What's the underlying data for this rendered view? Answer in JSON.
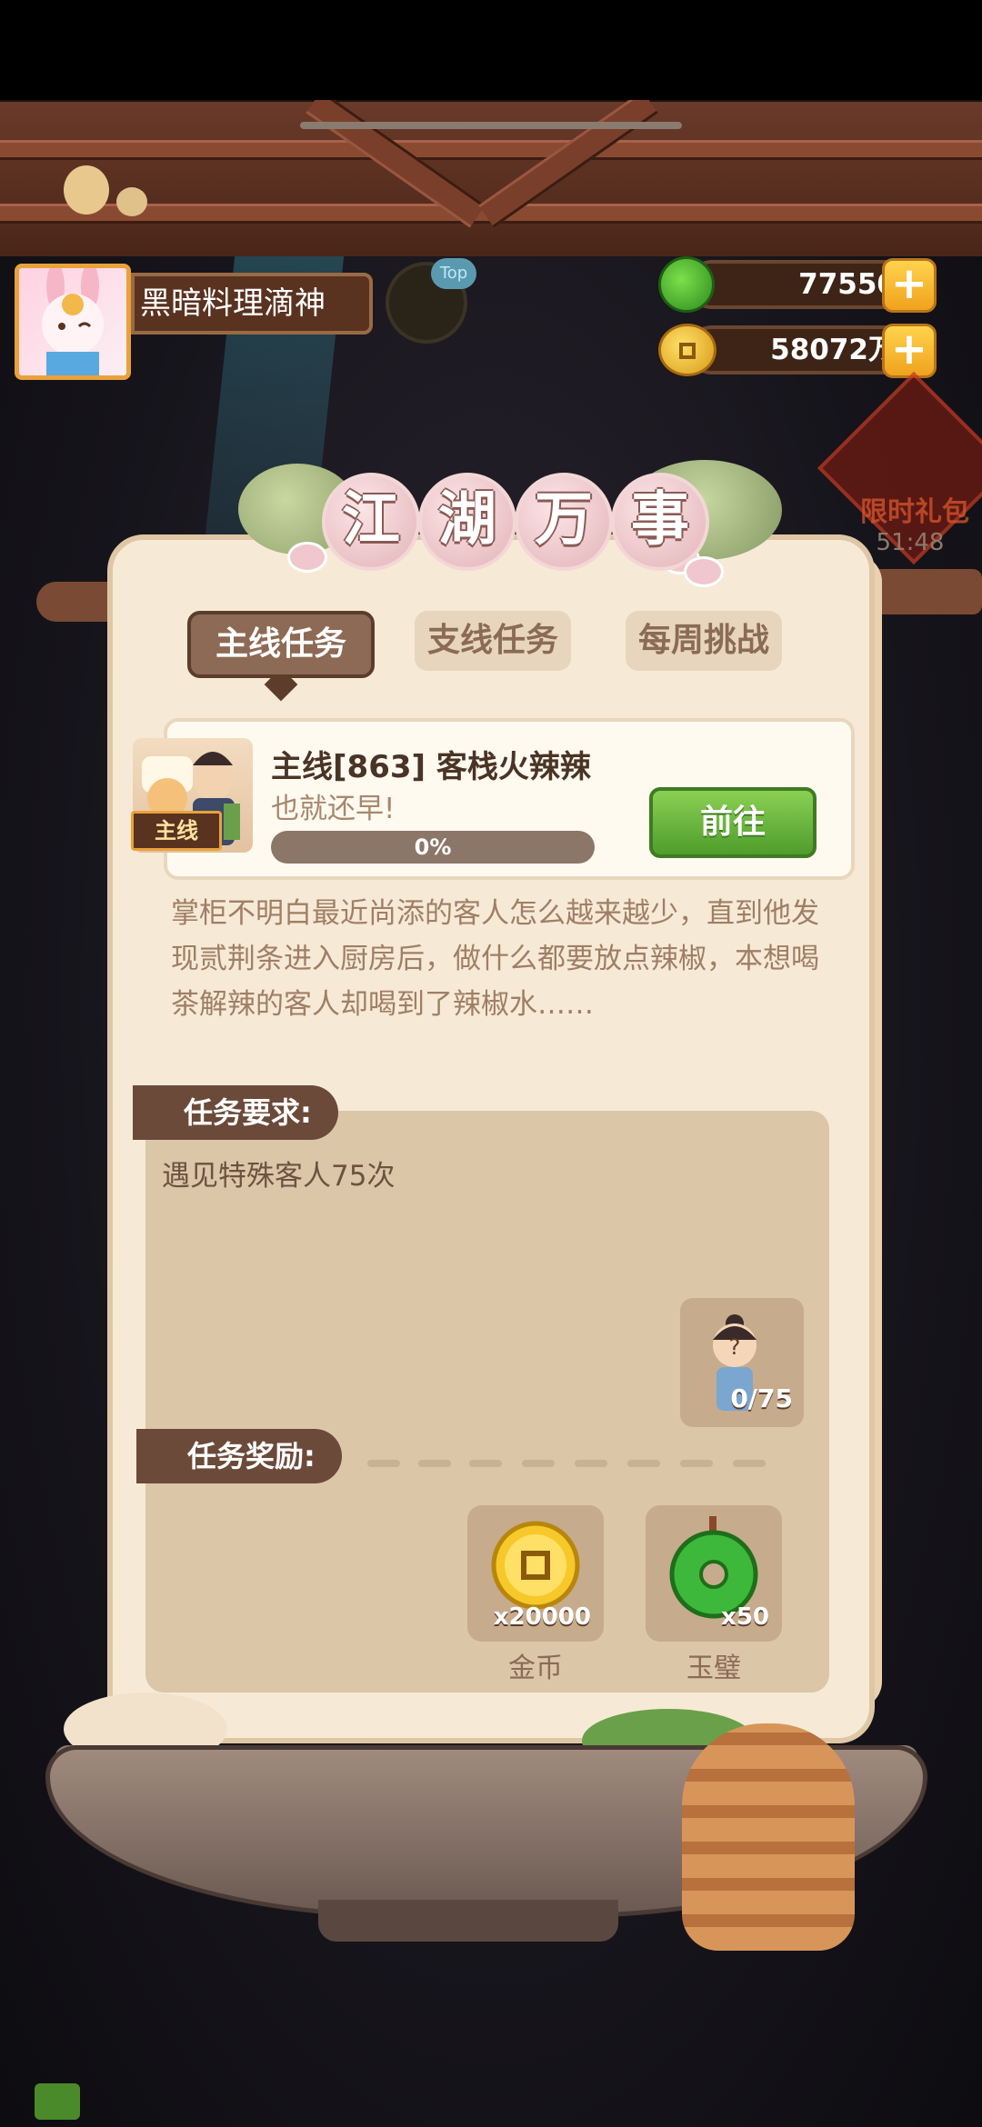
{
  "profile": {
    "name": "黑暗料理滴神",
    "top_badge": "Top"
  },
  "currency": {
    "jade": {
      "value": "77550",
      "plus": "+"
    },
    "coin": {
      "value": "58072万",
      "plus": "+"
    }
  },
  "promo": {
    "label": "限时礼包",
    "timer": "51:48"
  },
  "panel": {
    "title_chars": [
      "江",
      "湖",
      "万",
      "事"
    ],
    "tabs": {
      "main": "主线任务",
      "side": "支线任务",
      "weekly": "每周挑战"
    }
  },
  "quest": {
    "tag": "主线",
    "title": "主线[863] 客栈火辣辣",
    "subtitle": "也就还早!",
    "progress_text": "0%",
    "progress": 0,
    "go_label": "前往",
    "description": "掌柜不明白最近尚添的客人怎么越来越少，直到他发现贰荆条进入厨房后，做什么都要放点辣椒，本想喝茶解辣的客人却喝到了辣椒水……"
  },
  "requirements": {
    "label": "任务要求:",
    "text": "遇见特殊客人75次",
    "count": "0/75"
  },
  "rewards": {
    "label": "任务奖励:",
    "items": [
      {
        "qty": "x20000",
        "name": "金币",
        "icon": "gold-coin-icon"
      },
      {
        "qty": "x50",
        "name": "玉璧",
        "icon": "jade-disc-icon"
      }
    ]
  },
  "colors": {
    "panel_bg": "#f6ead6",
    "tab_active": "#8d6a55",
    "go_button": "#5fae3a",
    "label_bar": "#6b4a3a"
  }
}
